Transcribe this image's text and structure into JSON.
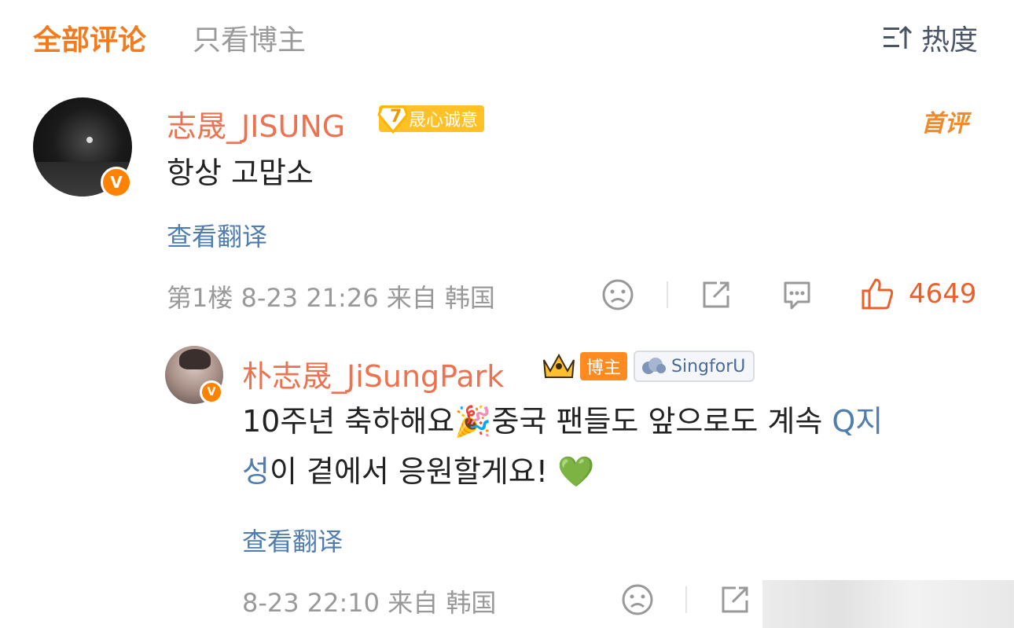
{
  "tabs": [
    {
      "label": "全部评论",
      "active": true
    },
    {
      "label": "只看博主",
      "active": false
    }
  ],
  "sort": {
    "label": "热度",
    "icon": "sort-icon"
  },
  "comment1": {
    "username": "志晟_JISUNG",
    "level": "7",
    "level_badge": "晟心诚意",
    "first_badge": "首评",
    "content": "항상 고맙소",
    "translate": "查看翻译",
    "meta": "第1楼 8-23 21:26 来自 韩国",
    "likes": "4649",
    "verified": "V"
  },
  "reply1": {
    "username": "朴志晟_JiSungPark",
    "blogger_badge": "博主",
    "fan_badge": "SingforU",
    "content_part1": "10주년 축하해요🎉중국 팬들도 앞으로도 계속 ",
    "hashtag_part1": "Q지",
    "hashtag_part2": "성",
    "content_part2": "이 곁에서 응원할게요! 💚",
    "translate": "查看翻译",
    "meta": "8-23 22:10 来自 韩国",
    "verified": "V"
  },
  "colors": {
    "accent": "#f27b1f",
    "username": "#eb7350",
    "link": "#507daf",
    "muted": "#999999",
    "like": "#eb5f2b"
  }
}
